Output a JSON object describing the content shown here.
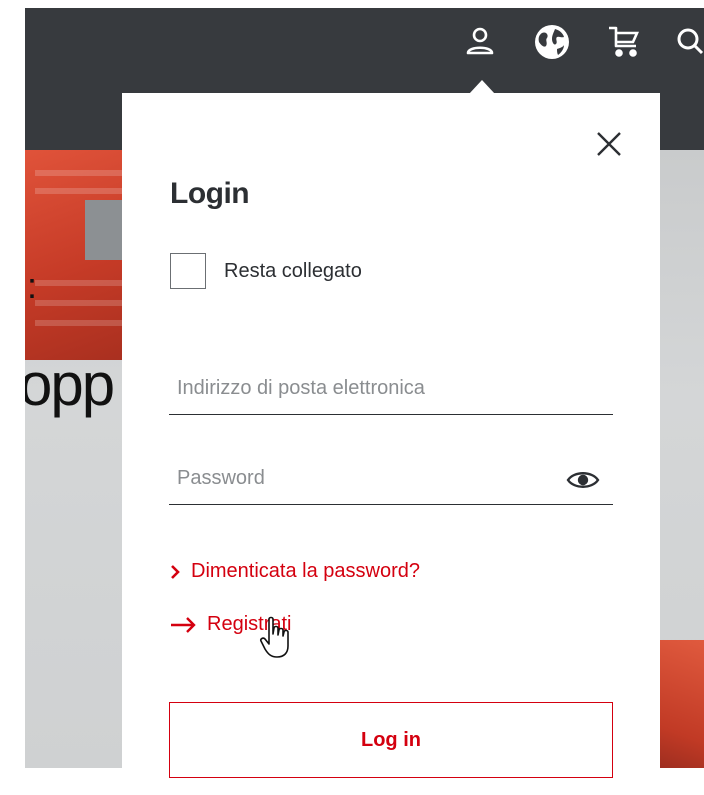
{
  "header": {
    "icons": [
      {
        "name": "user-icon"
      },
      {
        "name": "globe-icon"
      },
      {
        "name": "cart-icon"
      },
      {
        "name": "search-icon"
      }
    ]
  },
  "hero": {
    "text_partial": "opp",
    "dots": ":"
  },
  "login_panel": {
    "title": "Login",
    "remember_me_label": "Resta collegato",
    "email": {
      "placeholder": "Indirizzo di posta elettronica",
      "value": ""
    },
    "password": {
      "placeholder": "Password",
      "value": ""
    },
    "forgot_password_label": "Dimenticata la password?",
    "register_label": "Registrati",
    "login_button_label": "Log in"
  },
  "colors": {
    "accent": "#d4000f",
    "topbar": "#373a3e",
    "text": "#2c2f33"
  }
}
